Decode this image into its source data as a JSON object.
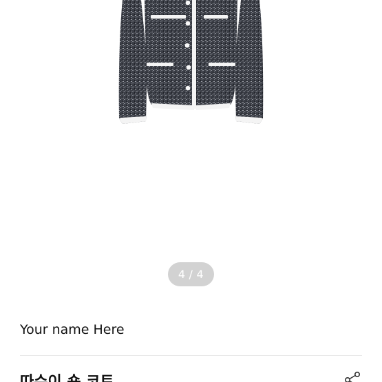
{
  "gallery": {
    "current_page": 4,
    "total_pages": 4,
    "current_label": "4",
    "separator": "/",
    "total_label": "4",
    "image_subject": "tweed-jacket"
  },
  "seller": {
    "name": "Your name Here"
  },
  "product": {
    "title": "따수이 숏 코트"
  },
  "actions": {
    "share_icon": "share-icon"
  },
  "colors": {
    "background": "#ffffff",
    "indicator_bg": "#d2d2d2",
    "indicator_text": "#ffffff",
    "text_primary": "#111111",
    "divider": "#e9e9e9",
    "jacket_tweed": "#3a3d44",
    "jacket_trim": "#f4f4f4"
  }
}
